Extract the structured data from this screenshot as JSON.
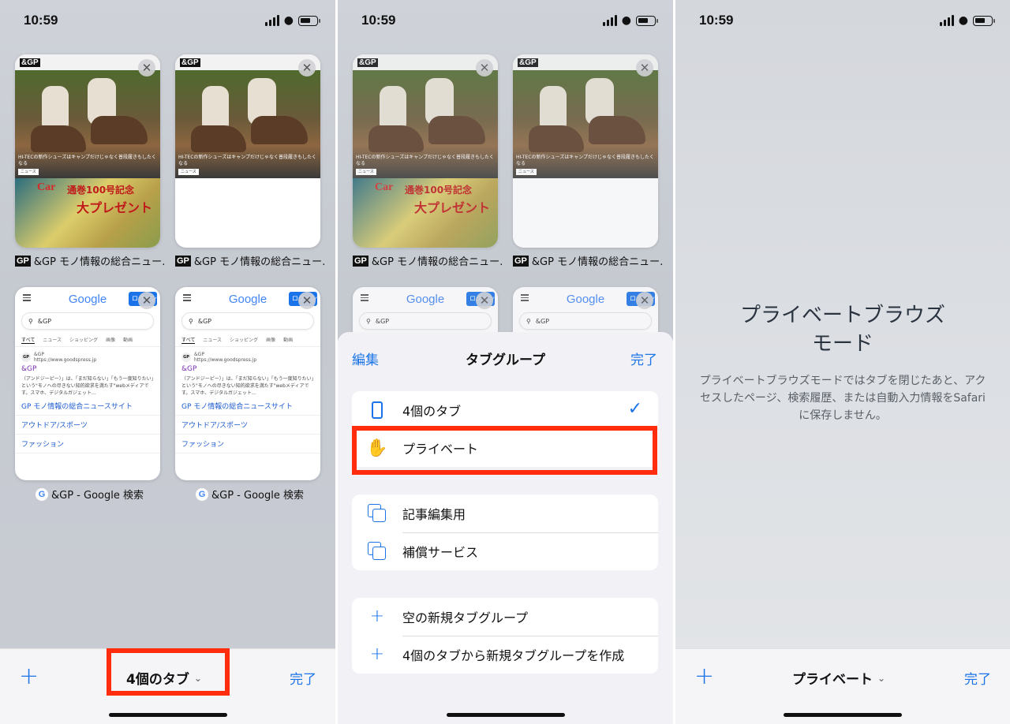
{
  "status": {
    "time": "10:59"
  },
  "panel1": {
    "cards": [
      {
        "brand": "&GP",
        "caption": "HI-TECの新作シューズはキャンプだけじゃなく普段履きもしたくなる",
        "tag": "ニュース",
        "promo1": "Car",
        "promo2": "通巻100号記念",
        "promo3": "大プレゼント",
        "label": "&GP モノ情報の総合ニュー…"
      },
      {
        "brand": "&GP",
        "caption": "HI-TECの新作シューズはキャンプだけじゃなく普段履きもしたくなる",
        "tag": "ニュース",
        "label": "&GP モノ情報の総合ニュー…"
      },
      {
        "google": "Google",
        "login": "ログイン",
        "query": "&GP",
        "tabs": [
          "すべて",
          "ニュース",
          "ショッピング",
          "画像",
          "動画"
        ],
        "site": "&GP",
        "site_url": "https://www.goodspress.jp",
        "result_title": "&GP",
        "desc": "（アンドジーピー）」は、「まだ知らない」「もう一度知りたい」という\"モノへの尽きない知的欲求を満たす\"webメディアです。スマホ、デジタルガジェット…",
        "links": [
          "GP モノ情報の総合ニュースサイト",
          "アウトドア/スポーツ",
          "ファッション"
        ],
        "label": "&GP - Google 検索"
      },
      {
        "google": "Google",
        "login": "ログイン",
        "query": "&GP",
        "tabs": [
          "すべて",
          "ニュース",
          "ショッピング",
          "画像",
          "動画"
        ],
        "site": "&GP",
        "site_url": "https://www.goodspress.jp",
        "result_title": "&GP",
        "desc": "（アンドジーピー）」は、「まだ知らない」「もう一度知りたい」という\"モノへの尽きない知的欲求を満たす\"webメディアです。スマホ、デジタルガジェット…",
        "links": [
          "GP モノ情報の総合ニュースサイト",
          "アウトドア/スポーツ",
          "ファッション"
        ],
        "label": "&GP - Google 検索"
      }
    ],
    "bottom": {
      "plus": "+",
      "title": "4個のタブ",
      "done": "完了"
    }
  },
  "panel2": {
    "sheet": {
      "edit": "編集",
      "title": "タブグループ",
      "done": "完了",
      "group1": [
        {
          "label": "4個のタブ",
          "icon": "phone-icon",
          "checked": true
        },
        {
          "label": "プライベート",
          "icon": "hand-icon"
        }
      ],
      "group2": [
        {
          "label": "記事編集用",
          "icon": "tabs-icon"
        },
        {
          "label": "補償サービス",
          "icon": "tabs-icon"
        }
      ],
      "group3": [
        {
          "label": "空の新規タブグループ",
          "icon": "plus-icon"
        },
        {
          "label": "4個のタブから新規タブグループを作成",
          "icon": "plus-icon"
        }
      ]
    }
  },
  "panel3": {
    "title": "プライベートブラウズ\nモード",
    "desc": "プライベートブラウズモードではタブを閉じたあと、アクセスしたページ、検索履歴、または自動入力情報をSafariに保存しません。",
    "bottom": {
      "plus": "+",
      "title": "プライベート",
      "done": "完了"
    }
  },
  "colors": {
    "accent": "#1a73e8",
    "highlight": "#ff2d0d"
  }
}
